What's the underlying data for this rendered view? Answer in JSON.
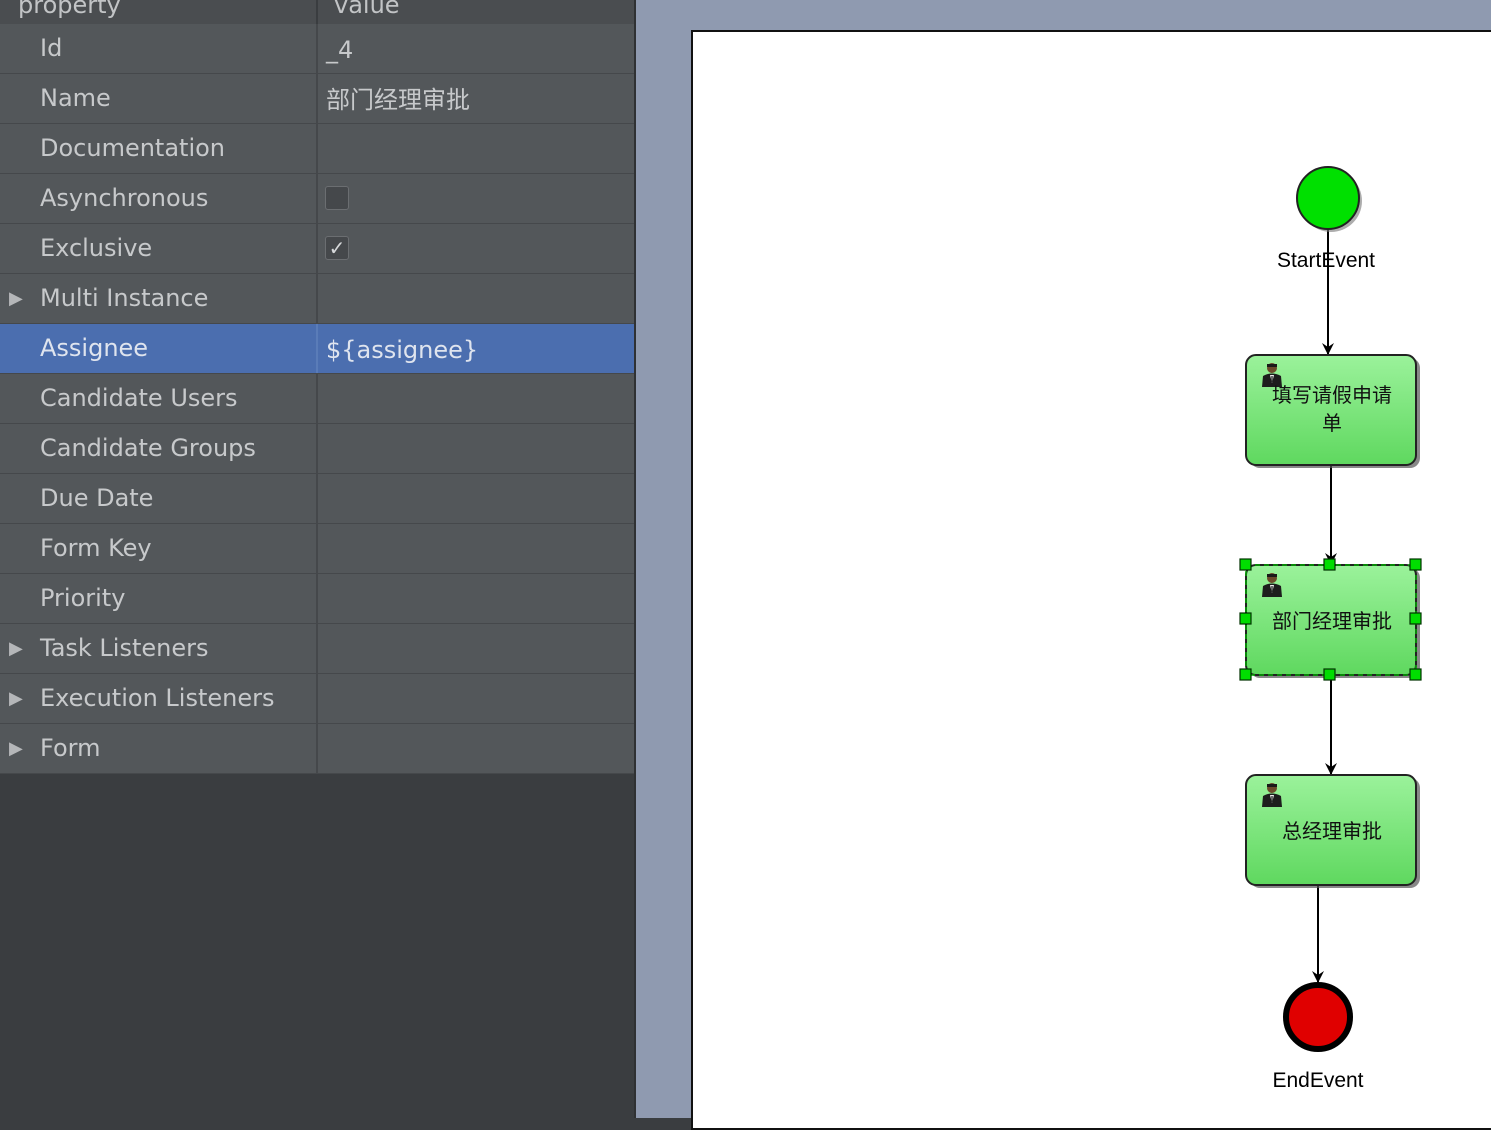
{
  "properties": {
    "header": {
      "property": "property",
      "value": "value"
    },
    "rows": [
      {
        "name": "Id",
        "value": "_4"
      },
      {
        "name": "Name",
        "value": "部门经理审批"
      },
      {
        "name": "Documentation",
        "value": ""
      },
      {
        "name": "Asynchronous",
        "checked": false
      },
      {
        "name": "Exclusive",
        "checked": true
      },
      {
        "name": "Multi Instance",
        "expandable": true
      },
      {
        "name": "Assignee",
        "value": "${assignee}",
        "selected": true
      },
      {
        "name": "Candidate Users",
        "value": ""
      },
      {
        "name": "Candidate Groups",
        "value": ""
      },
      {
        "name": "Due Date",
        "value": ""
      },
      {
        "name": "Form Key",
        "value": ""
      },
      {
        "name": "Priority",
        "value": ""
      },
      {
        "name": "Task Listeners",
        "expandable": true
      },
      {
        "name": "Execution Listeners",
        "expandable": true
      },
      {
        "name": "Form",
        "expandable": true
      }
    ]
  },
  "diagram": {
    "start_event": "StartEvent",
    "end_event": "EndEvent",
    "tasks": [
      {
        "label": "填写请假申请单",
        "label_line1": "填写请假申请",
        "label_line2": "单"
      },
      {
        "label": "部门经理审批",
        "selected": true
      },
      {
        "label": "总经理审批"
      }
    ],
    "colors": {
      "start": "#00e000",
      "end": "#e00000",
      "task_top": "#9bf29b",
      "task_bottom": "#5fd85f",
      "selection_handle": "#00dd00",
      "row_selected": "#4b6eaf"
    },
    "icons": [
      "user-task-icon"
    ]
  }
}
